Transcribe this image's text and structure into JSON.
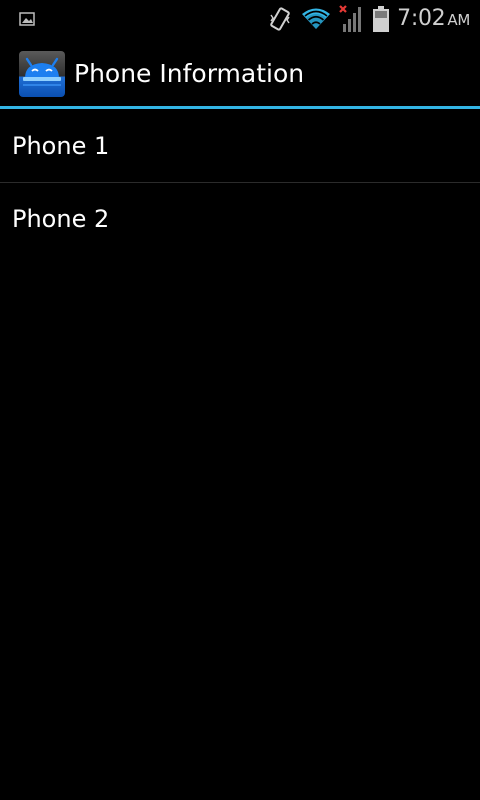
{
  "status_bar": {
    "notification_icon": "image-icon",
    "icons": [
      "vibrate-icon",
      "wifi-icon",
      "signal-icon",
      "battery-icon"
    ],
    "time": "7:02",
    "ampm": "AM",
    "wifi_color": "#33b5e5",
    "no_signal_mark_color": "#e53935"
  },
  "action_bar": {
    "app_icon": "android-app-icon",
    "title": "Phone Information",
    "accent_color": "#33b5e5"
  },
  "list": {
    "items": [
      {
        "label": "Phone 1"
      },
      {
        "label": "Phone 2"
      }
    ]
  }
}
